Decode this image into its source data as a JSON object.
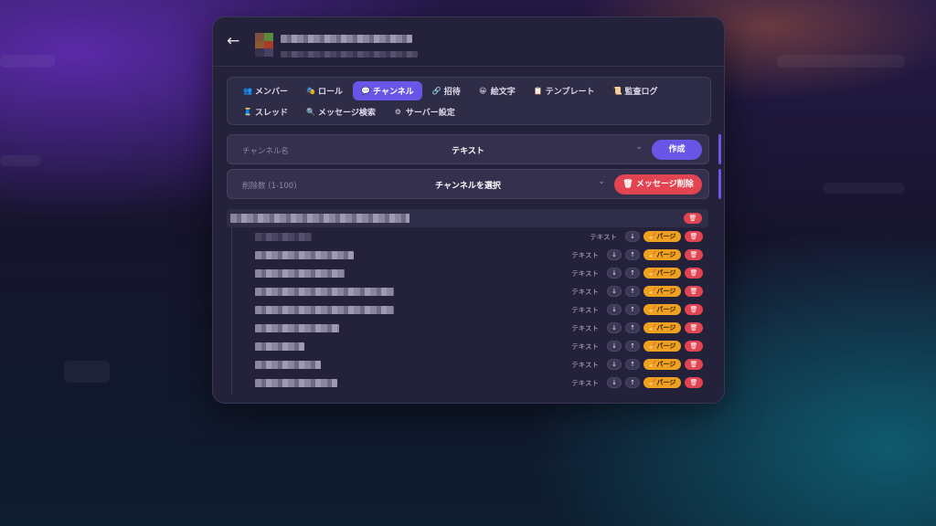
{
  "header": {
    "back_label": "←"
  },
  "tabs": [
    {
      "label": "メンバー",
      "icon": "users-icon",
      "glyph": "👥"
    },
    {
      "label": "ロール",
      "icon": "role-icon",
      "glyph": "🎭"
    },
    {
      "label": "チャンネル",
      "icon": "chat-icon",
      "glyph": "💬",
      "active": true
    },
    {
      "label": "招待",
      "icon": "link-icon",
      "glyph": "🔗"
    },
    {
      "label": "絵文字",
      "icon": "emoji-icon",
      "glyph": "😀"
    },
    {
      "label": "テンプレート",
      "icon": "template-icon",
      "glyph": "📋"
    },
    {
      "label": "監査ログ",
      "icon": "audit-log-icon",
      "glyph": "📜"
    },
    {
      "label": "スレッド",
      "icon": "thread-icon",
      "glyph": "🧵"
    },
    {
      "label": "メッセージ検索",
      "icon": "search-icon",
      "glyph": "🔍"
    },
    {
      "label": "サーバー設定",
      "icon": "gear-icon",
      "glyph": "⚙"
    }
  ],
  "create_form": {
    "name_placeholder": "チャンネル名",
    "type_value": "テキスト",
    "create_label": "作成"
  },
  "delete_form": {
    "count_placeholder": "削除数 (1-100)",
    "channel_value": "チャンネルを選択",
    "delete_label": "メッセージ削除"
  },
  "channels": [
    {
      "type": "テキスト",
      "has_up": false
    },
    {
      "type": "テキスト",
      "has_up": true
    },
    {
      "type": "テキスト",
      "has_up": true
    },
    {
      "type": "テキスト",
      "has_up": true
    },
    {
      "type": "テキスト",
      "has_up": true
    },
    {
      "type": "テキスト",
      "has_up": true
    },
    {
      "type": "テキスト",
      "has_up": true
    },
    {
      "type": "テキスト",
      "has_up": true
    },
    {
      "type": "テキスト",
      "has_up": true
    }
  ],
  "row_actions": {
    "down": "↓",
    "up": "↑",
    "purge_label": "パージ",
    "purge_icon": "🧹",
    "trash_icon": "🗑"
  },
  "colors": {
    "accent": "#6a56e6",
    "danger": "#e24452",
    "warning": "#f0a020"
  }
}
